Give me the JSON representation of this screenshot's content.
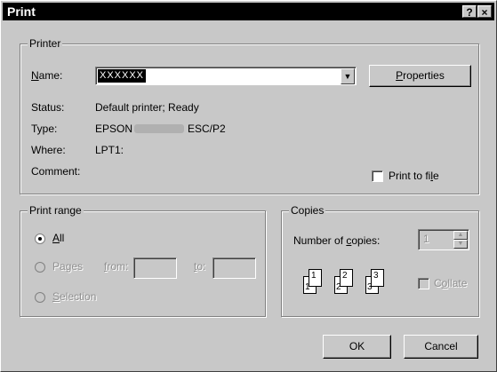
{
  "window": {
    "title": "Print",
    "help_label": "?",
    "close_label": "×"
  },
  "printer": {
    "group_label": "Printer",
    "name_label": "Name:",
    "name_value": "XXXXXX",
    "properties_label": "Properties",
    "status_label": "Status:",
    "status_value": "Default printer; Ready",
    "type_label": "Type:",
    "type_value_prefix": "EPSON",
    "type_value_suffix": "ESC/P2",
    "where_label": "Where:",
    "where_value": "LPT1:",
    "comment_label": "Comment:",
    "print_to_file_label": "Print to file",
    "print_to_file_checked": false
  },
  "print_range": {
    "group_label": "Print range",
    "all_label": "All",
    "pages_label": "Pages",
    "from_label": "from:",
    "to_label": "to:",
    "selection_label": "Selection",
    "selected": "all"
  },
  "copies": {
    "group_label": "Copies",
    "number_label": "Number of copies:",
    "number_value": "1",
    "collate_label": "Collate",
    "collate_checked": false,
    "pages": [
      "1",
      "1",
      "2",
      "2",
      "3",
      "3"
    ]
  },
  "buttons": {
    "ok_label": "OK",
    "cancel_label": "Cancel"
  }
}
